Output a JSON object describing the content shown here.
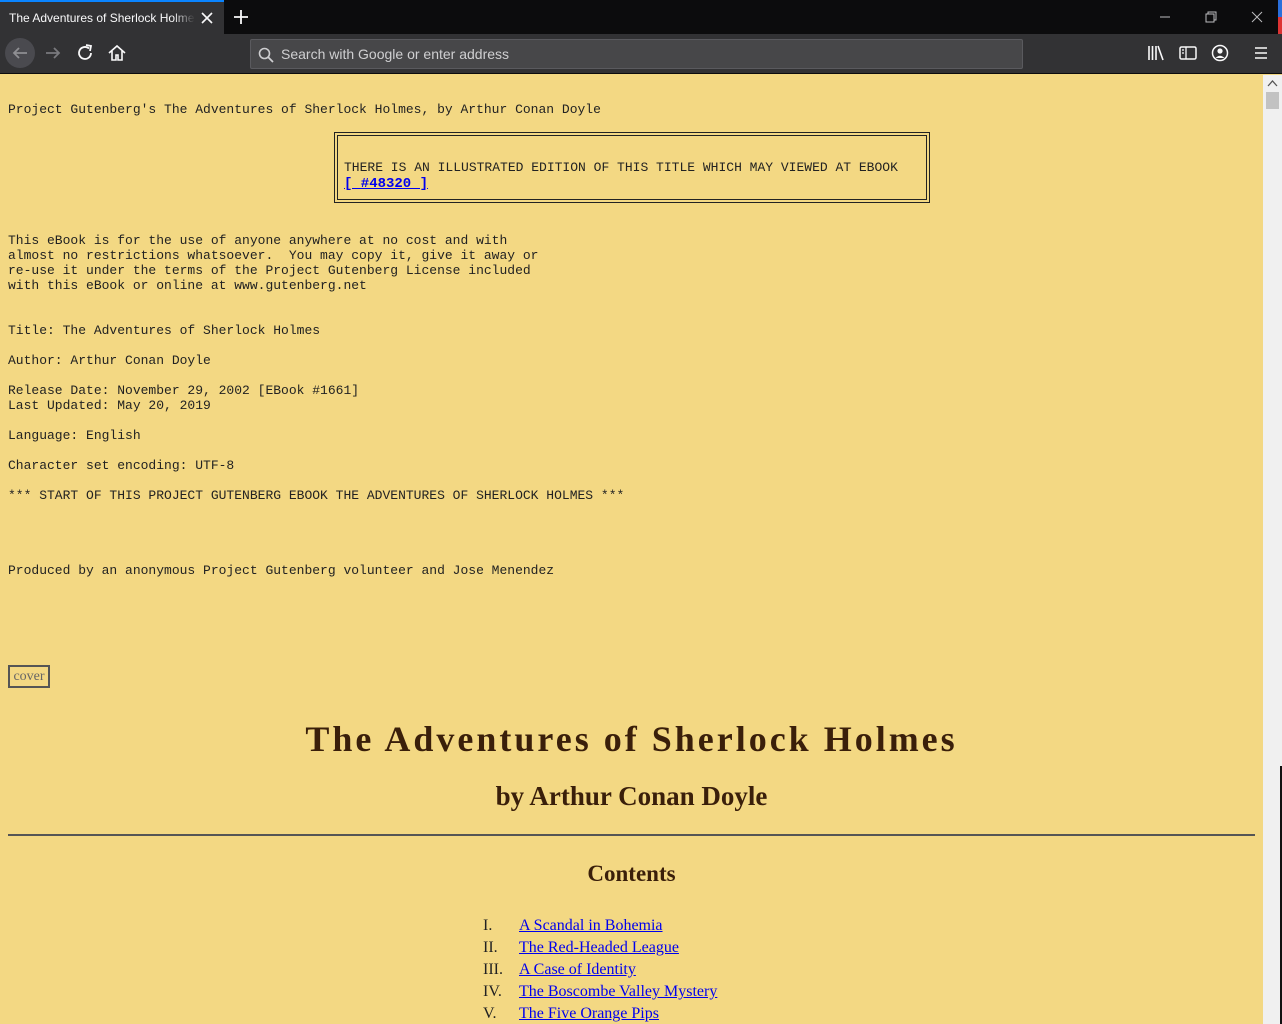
{
  "browser": {
    "tab_title": "The Adventures of Sherlock Holmes, by Arthur Conan Doyle",
    "url_placeholder": "Search with Google or enter address"
  },
  "page": {
    "header_line": "Project Gutenberg's The Adventures of Sherlock Holmes, by Arthur Conan Doyle",
    "notice_text": "THERE IS AN ILLUSTRATED EDITION OF THIS TITLE WHICH MAY VIEWED AT EBOOK",
    "notice_link": "[ #48320 ]",
    "license_text": "This eBook is for the use of anyone anywhere at no cost and with\nalmost no restrictions whatsoever.  You may copy it, give it away or\nre-use it under the terms of the Project Gutenberg License included\nwith this eBook or online at www.gutenberg.net",
    "title_line": "Title: The Adventures of Sherlock Holmes",
    "author_line": "Author: Arthur Conan Doyle",
    "dates_text": "Release Date: November 29, 2002 [EBook #1661]\nLast Updated: May 20, 2019",
    "language_line": "Language: English",
    "encoding_line": "Character set encoding: UTF-8",
    "start_line": "*** START OF THIS PROJECT GUTENBERG EBOOK THE ADVENTURES OF SHERLOCK HOLMES ***",
    "produced_line": "Produced by an anonymous Project Gutenberg volunteer and Jose Menendez",
    "cover_alt": "cover",
    "book_title": "The Adventures of Sherlock Holmes",
    "byline": "by Arthur Conan Doyle",
    "contents_heading": "Contents",
    "contents": [
      {
        "num": "I.",
        "title": "A Scandal in Bohemia"
      },
      {
        "num": "II.",
        "title": "The Red-Headed League"
      },
      {
        "num": "III.",
        "title": "A Case of Identity"
      },
      {
        "num": "IV.",
        "title": "The Boscombe Valley Mystery"
      },
      {
        "num": "V.",
        "title": "The Five Orange Pips"
      }
    ]
  },
  "colors": {
    "page_background": "#f3d883",
    "link": "#0000ee",
    "heading": "#3a1f0a"
  }
}
